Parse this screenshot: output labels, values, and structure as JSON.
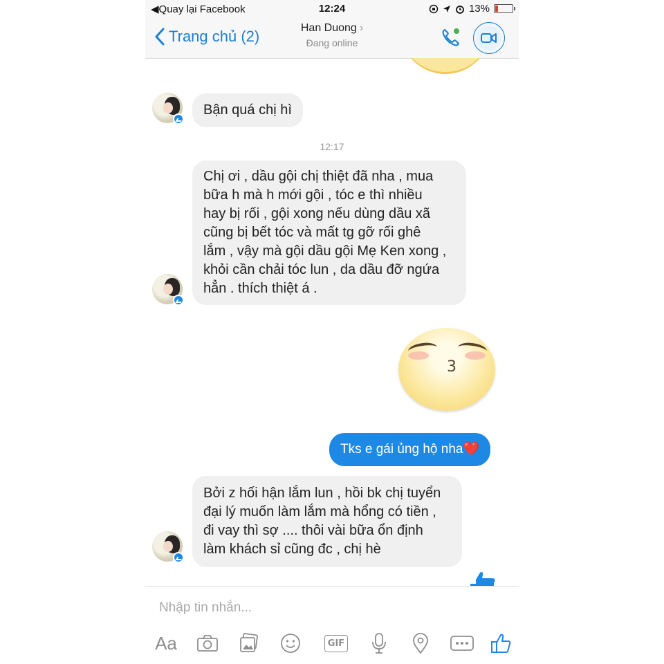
{
  "status_bar": {
    "back_app": "Quay lại Facebook",
    "time": "12:24",
    "battery": "13%"
  },
  "header": {
    "back_label": "Trang chủ (2)",
    "contact_name": "Han Duong",
    "contact_status": "Đang online"
  },
  "messages": [
    {
      "from": "them",
      "text": "Bận quá chị hì"
    },
    {
      "timestamp": "12:17"
    },
    {
      "from": "them",
      "lines": [
        "Chị ơi , dầu gội chị thiệt đã nha , mua",
        "bữa h mà h mới gội , tóc e thì nhiều",
        "hay bị rối , gội xong nếu dùng dầu xã",
        "cũng bị bết tóc và mất tg gỡ rối ghê",
        "lắm , vậy mà gội dầu gội Mẹ Ken xong ,",
        "khỏi cần chải tóc lun , da dầu đỡ ngứa",
        "hẳn . thích thiệt á ."
      ]
    },
    {
      "from": "me",
      "type": "sticker",
      "icon": "kiss-face-sticker"
    },
    {
      "from": "me",
      "text": "Tks e gái ủng hộ nha❤️"
    },
    {
      "from": "them",
      "lines": [
        "Bởi z hối hận lắm lun , hồi bk chị tuyển",
        "đại lý muốn làm lắm mà hổng có tiền ,",
        "đi vay thì sợ .... thôi vài bữa ổn định",
        "làm khách sỉ cũng đc , chị hè"
      ]
    }
  ],
  "composer": {
    "placeholder": "Nhập tin nhắn...",
    "aa_label": "Aa",
    "gif_label": "GIF"
  },
  "colors": {
    "accent": "#1e88e5",
    "bubble_in": "#f0f0f0",
    "online": "#4caf50"
  }
}
